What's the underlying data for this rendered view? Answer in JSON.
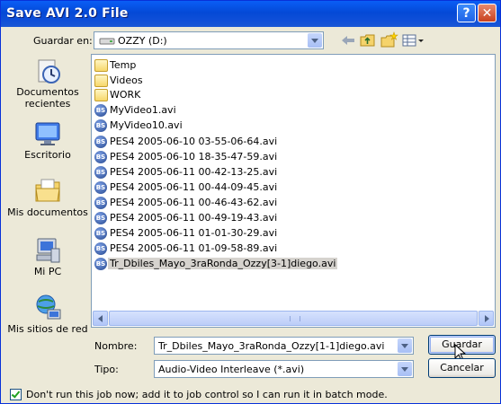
{
  "window": {
    "title": "Save AVI 2.0 File",
    "help_glyph": "?",
    "close_glyph": "✕"
  },
  "save_in": {
    "label": "Guardar en:",
    "value": "OZZY (D:)"
  },
  "places": [
    {
      "label": "Documentos recientes",
      "icon": "recent-documents-icon"
    },
    {
      "label": "Escritorio",
      "icon": "desktop-icon"
    },
    {
      "label": "Mis documentos",
      "icon": "my-documents-icon"
    },
    {
      "label": "Mi PC",
      "icon": "my-computer-icon"
    },
    {
      "label": "Mis sitios de red",
      "icon": "network-places-icon"
    }
  ],
  "files": [
    {
      "name": "Temp",
      "type": "folder"
    },
    {
      "name": "Videos",
      "type": "folder"
    },
    {
      "name": "WORK",
      "type": "folder"
    },
    {
      "name": "MyVideo1.avi",
      "type": "avi"
    },
    {
      "name": "MyVideo10.avi",
      "type": "avi"
    },
    {
      "name": "PES4 2005-06-10 03-55-06-64.avi",
      "type": "avi"
    },
    {
      "name": "PES4 2005-06-10 18-35-47-59.avi",
      "type": "avi"
    },
    {
      "name": "PES4 2005-06-11 00-42-13-25.avi",
      "type": "avi"
    },
    {
      "name": "PES4 2005-06-11 00-44-09-45.avi",
      "type": "avi"
    },
    {
      "name": "PES4 2005-06-11 00-46-43-62.avi",
      "type": "avi"
    },
    {
      "name": "PES4 2005-06-11 00-49-19-43.avi",
      "type": "avi"
    },
    {
      "name": "PES4 2005-06-11 01-01-30-29.avi",
      "type": "avi"
    },
    {
      "name": "PES4 2005-06-11 01-09-58-89.avi",
      "type": "avi"
    },
    {
      "name": "Tr_Dbiles_Mayo_3raRonda_Ozzy[3-1]diego.avi",
      "type": "avi",
      "selected": true
    }
  ],
  "filename": {
    "label": "Nombre:",
    "value": "Tr_Dbiles_Mayo_3raRonda_Ozzy[1-1]diego.avi"
  },
  "filetype": {
    "label": "Tipo:",
    "value": "Audio-Video Interleave (*.avi)"
  },
  "buttons": {
    "save": "Guardar",
    "cancel": "Cancelar"
  },
  "batch_option": {
    "label": "Don't run this job now; add it to job control so I can run it in batch mode.",
    "checked": true
  },
  "avi_icon_text": "BS"
}
